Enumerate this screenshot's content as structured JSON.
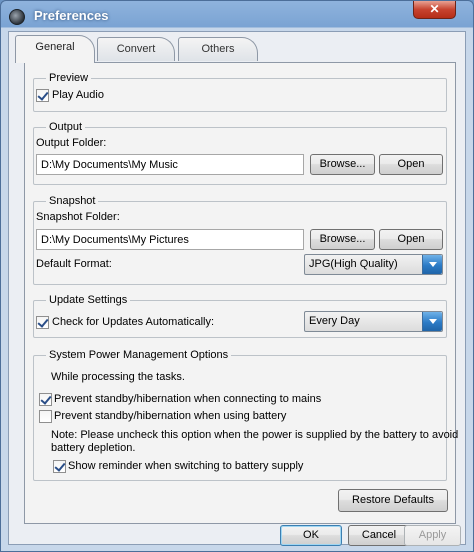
{
  "window": {
    "title": "Preferences",
    "close_glyph": "✕",
    "icon": "app-logo-icon"
  },
  "tabs": [
    {
      "label": "General",
      "active": true
    },
    {
      "label": "Convert",
      "active": false
    },
    {
      "label": "Others",
      "active": false
    }
  ],
  "preview": {
    "title": "Preview",
    "play_audio": {
      "label": "Play Audio",
      "checked": true
    }
  },
  "output": {
    "title": "Output",
    "folder_label": "Output Folder:",
    "folder_value": "D:\\My Documents\\My Music",
    "browse_label": "Browse...",
    "open_label": "Open"
  },
  "snapshot": {
    "title": "Snapshot",
    "folder_label": "Snapshot Folder:",
    "folder_value": "D:\\My Documents\\My Pictures",
    "browse_label": "Browse...",
    "open_label": "Open",
    "format_label": "Default Format:",
    "format_value": "JPG(High Quality)"
  },
  "update": {
    "title": "Update Settings",
    "check_label": "Check for Updates Automatically:",
    "checked": true,
    "frequency_value": "Every Day"
  },
  "power": {
    "title": "System Power Management Options",
    "intro": "While processing the tasks.",
    "prevent_mains": {
      "label": "Prevent standby/hibernation when connecting to mains",
      "checked": true
    },
    "prevent_battery": {
      "label": "Prevent standby/hibernation when using battery",
      "checked": false
    },
    "note_line1": "Note: Please uncheck this option when the power is supplied by the battery to avoid",
    "note_line2": "battery depletion.",
    "reminder": {
      "label": "Show reminder when switching to battery supply",
      "checked": true
    }
  },
  "footer": {
    "restore_label": "Restore Defaults",
    "ok_label": "OK",
    "cancel_label": "Cancel",
    "apply_label": "Apply"
  }
}
